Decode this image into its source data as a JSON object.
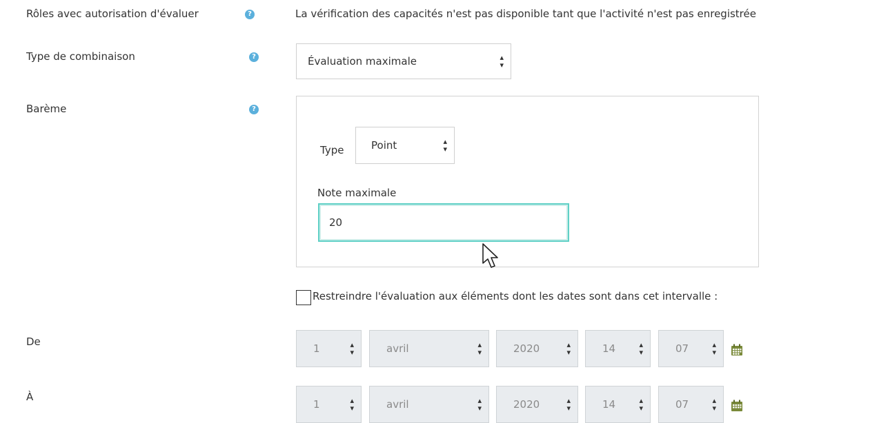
{
  "rows": {
    "roles": {
      "label": "Rôles avec autorisation d'évaluer",
      "info": "La vérification des capacités n'est pas disponible tant que l'activité n'est pas enregistrée"
    },
    "combination": {
      "label": "Type de combinaison",
      "value": "Évaluation maximale"
    },
    "scale": {
      "label": "Barème",
      "type_label": "Type",
      "type_value": "Point",
      "max_label": "Note maximale",
      "max_value": "20"
    },
    "restrict": {
      "label": "Restreindre l'évaluation aux éléments dont les dates sont dans cet intervalle :",
      "checked": false
    },
    "from": {
      "label": "De",
      "day": "1",
      "month": "avril",
      "year": "2020",
      "hour": "14",
      "minute": "07"
    },
    "to": {
      "label": "À",
      "day": "1",
      "month": "avril",
      "year": "2020",
      "hour": "14",
      "minute": "07"
    }
  },
  "icons": {
    "help": "help-icon",
    "calendar": "calendar-icon",
    "select_arrow": "updown-arrow-icon",
    "cursor": "mouse-pointer-icon"
  },
  "colors": {
    "help": "#5bb0dc",
    "focus_border": "#5fd0c6",
    "calendar": "#7a8a3a"
  }
}
